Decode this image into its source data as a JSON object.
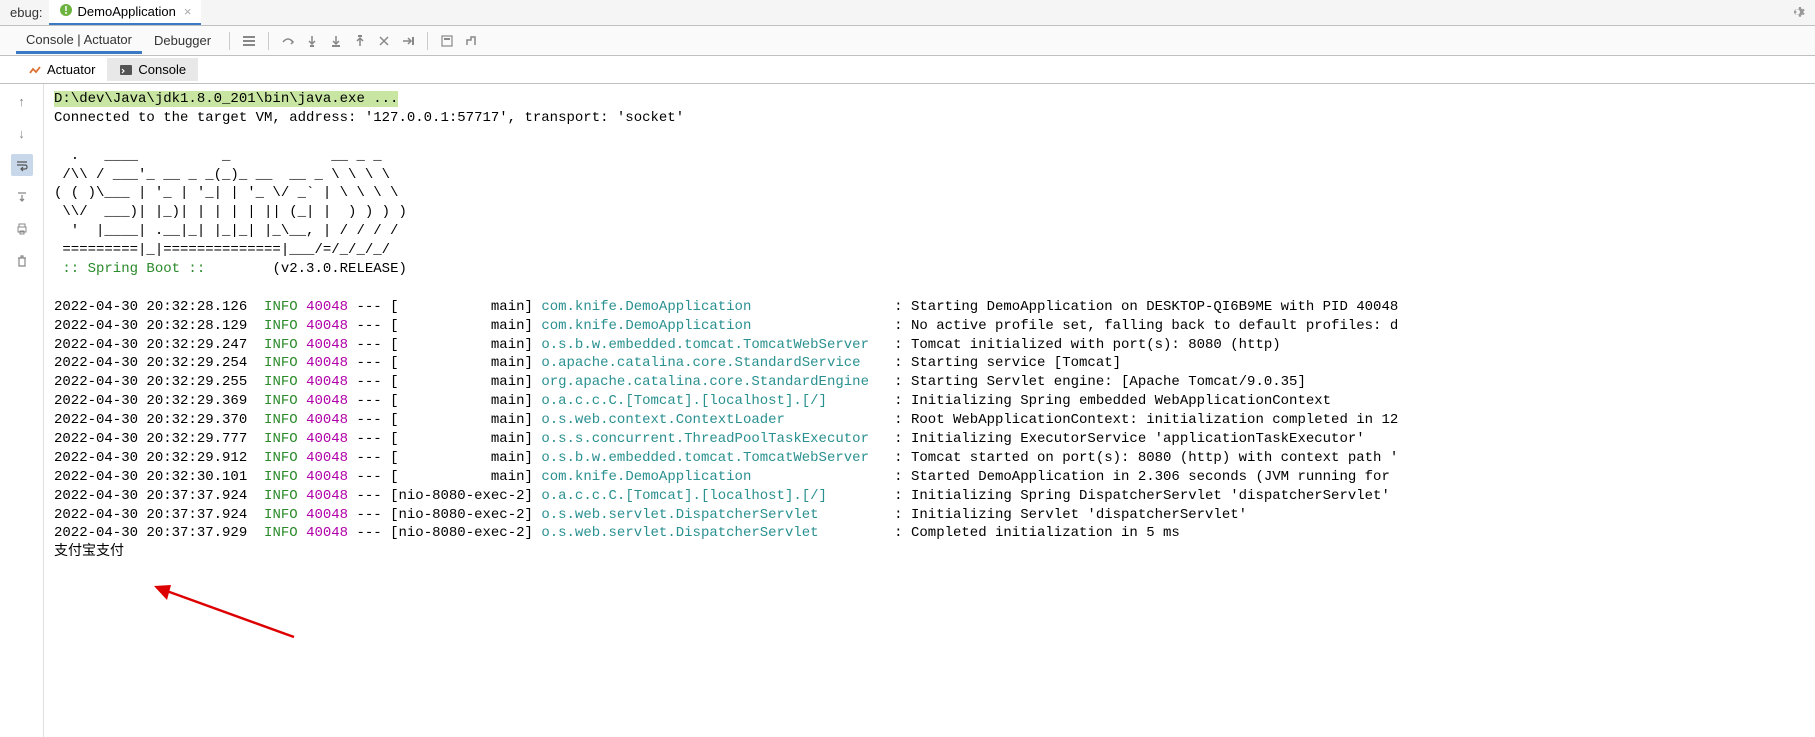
{
  "topbar": {
    "label": "ebug:",
    "run_config": "DemoApplication"
  },
  "toolbar": {
    "tabs": {
      "console_actuator": "Console | Actuator",
      "debugger": "Debugger"
    }
  },
  "subtabs": {
    "actuator": "Actuator",
    "console": "Console"
  },
  "console": {
    "cmd": "D:\\dev\\Java\\jdk1.8.0_201\\bin\\java.exe ...",
    "connected": "Connected to the target VM, address: '127.0.0.1:57717', transport: 'socket'",
    "banner": [
      "  .   ____          _            __ _ _",
      " /\\\\ / ___'_ __ _ _(_)_ __  __ _ \\ \\ \\ \\",
      "( ( )\\___ | '_ | '_| | '_ \\/ _` | \\ \\ \\ \\",
      " \\\\/  ___)| |_)| | | | | || (_| |  ) ) ) )",
      "  '  |____| .__|_| |_|_| |_\\__, | / / / /",
      " =========|_|==============|___/=/_/_/_/"
    ],
    "spring_label": " :: Spring Boot ::",
    "spring_version": "        (v2.3.0.RELEASE)",
    "logs": [
      {
        "ts": "2022-04-30 20:32:28.126",
        "lvl": "INFO",
        "pid": "40048",
        "thr": "[           main]",
        "logger": "com.knife.DemoApplication                ",
        "msg": ": Starting DemoApplication on DESKTOP-QI6B9ME with PID 40048"
      },
      {
        "ts": "2022-04-30 20:32:28.129",
        "lvl": "INFO",
        "pid": "40048",
        "thr": "[           main]",
        "logger": "com.knife.DemoApplication                ",
        "msg": ": No active profile set, falling back to default profiles: d"
      },
      {
        "ts": "2022-04-30 20:32:29.247",
        "lvl": "INFO",
        "pid": "40048",
        "thr": "[           main]",
        "logger": "o.s.b.w.embedded.tomcat.TomcatWebServer  ",
        "msg": ": Tomcat initialized with port(s): 8080 (http)"
      },
      {
        "ts": "2022-04-30 20:32:29.254",
        "lvl": "INFO",
        "pid": "40048",
        "thr": "[           main]",
        "logger": "o.apache.catalina.core.StandardService   ",
        "msg": ": Starting service [Tomcat]"
      },
      {
        "ts": "2022-04-30 20:32:29.255",
        "lvl": "INFO",
        "pid": "40048",
        "thr": "[           main]",
        "logger": "org.apache.catalina.core.StandardEngine  ",
        "msg": ": Starting Servlet engine: [Apache Tomcat/9.0.35]"
      },
      {
        "ts": "2022-04-30 20:32:29.369",
        "lvl": "INFO",
        "pid": "40048",
        "thr": "[           main]",
        "logger": "o.a.c.c.C.[Tomcat].[localhost].[/]       ",
        "msg": ": Initializing Spring embedded WebApplicationContext"
      },
      {
        "ts": "2022-04-30 20:32:29.370",
        "lvl": "INFO",
        "pid": "40048",
        "thr": "[           main]",
        "logger": "o.s.web.context.ContextLoader            ",
        "msg": ": Root WebApplicationContext: initialization completed in 12"
      },
      {
        "ts": "2022-04-30 20:32:29.777",
        "lvl": "INFO",
        "pid": "40048",
        "thr": "[           main]",
        "logger": "o.s.s.concurrent.ThreadPoolTaskExecutor  ",
        "msg": ": Initializing ExecutorService 'applicationTaskExecutor'"
      },
      {
        "ts": "2022-04-30 20:32:29.912",
        "lvl": "INFO",
        "pid": "40048",
        "thr": "[           main]",
        "logger": "o.s.b.w.embedded.tomcat.TomcatWebServer  ",
        "msg": ": Tomcat started on port(s): 8080 (http) with context path '"
      },
      {
        "ts": "2022-04-30 20:32:30.101",
        "lvl": "INFO",
        "pid": "40048",
        "thr": "[           main]",
        "logger": "com.knife.DemoApplication                ",
        "msg": ": Started DemoApplication in 2.306 seconds (JVM running for "
      },
      {
        "ts": "2022-04-30 20:37:37.924",
        "lvl": "INFO",
        "pid": "40048",
        "thr": "[nio-8080-exec-2]",
        "logger": "o.a.c.c.C.[Tomcat].[localhost].[/]       ",
        "msg": ": Initializing Spring DispatcherServlet 'dispatcherServlet'"
      },
      {
        "ts": "2022-04-30 20:37:37.924",
        "lvl": "INFO",
        "pid": "40048",
        "thr": "[nio-8080-exec-2]",
        "logger": "o.s.web.servlet.DispatcherServlet        ",
        "msg": ": Initializing Servlet 'dispatcherServlet'"
      },
      {
        "ts": "2022-04-30 20:37:37.929",
        "lvl": "INFO",
        "pid": "40048",
        "thr": "[nio-8080-exec-2]",
        "logger": "o.s.web.servlet.DispatcherServlet        ",
        "msg": ": Completed initialization in 5 ms"
      }
    ],
    "output": "支付宝支付"
  }
}
